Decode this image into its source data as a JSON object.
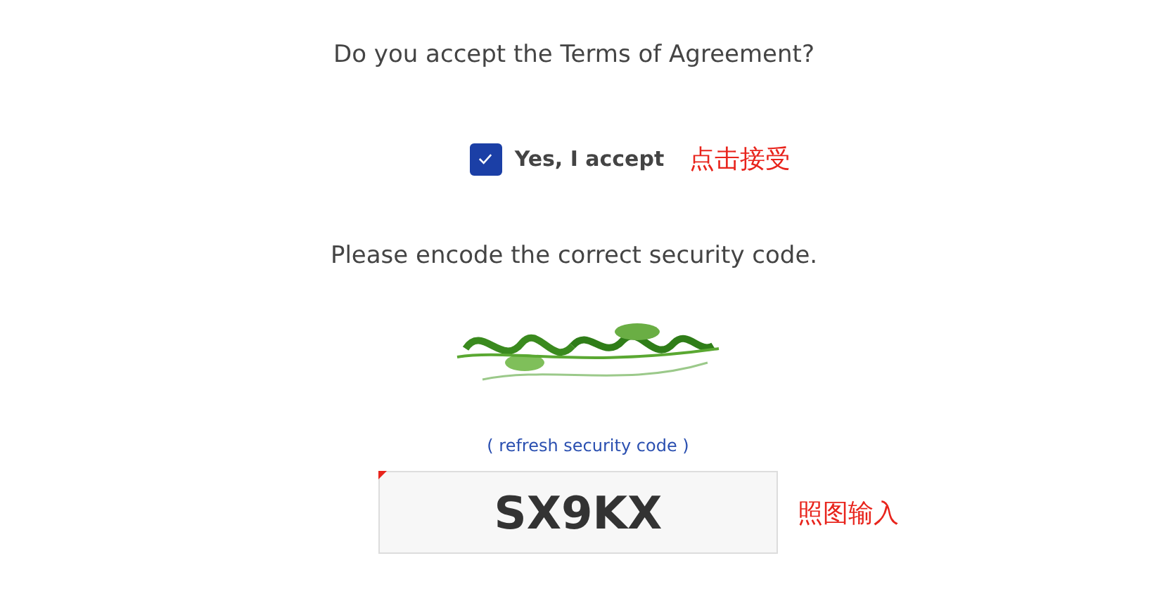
{
  "terms_question": "Do you accept the Terms of Agreement?",
  "accept": {
    "label": "Yes, I accept",
    "checked": true,
    "annotation": "点击接受"
  },
  "security_prompt": "Please encode the correct security code.",
  "refresh_link": "( refresh security code )",
  "code_field": {
    "value": "SX9KX",
    "annotation": "照图输入"
  }
}
